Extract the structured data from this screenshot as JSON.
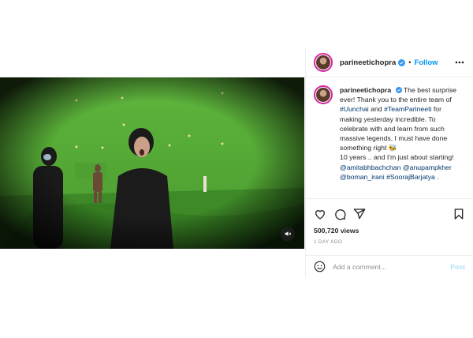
{
  "header": {
    "username": "parineetichopra",
    "separator": "•",
    "follow_label": "Follow"
  },
  "caption": {
    "username": "parineetichopra",
    "text_1": "The best surprise ever! Thank you to the entire team of",
    "tag_unchai": "#Uunchai",
    "and": "and",
    "tag_team": "#TeamParineeti",
    "text_2": "for making yesterday incredible. To celebrate with and learn from such massive legends, I must have done something right 🐝",
    "text_3": "10 years .. and I'm just about starting!",
    "mention_1": "@amitabhbachchan",
    "mention_2": "@anupampkher",
    "mention_3": "@boman_irani",
    "tag_sooraj": "#SoorajBarjatya",
    "end": "."
  },
  "stats": {
    "views": "500,720 views",
    "time": "1 DAY AGO"
  },
  "comment": {
    "placeholder": "Add a comment...",
    "post_label": "Post"
  },
  "icons": {
    "like": "heart-icon",
    "comment": "comment-icon",
    "share": "share-icon",
    "save": "bookmark-icon",
    "mute": "muted-speaker-icon",
    "more": "more-icon",
    "emoji": "emoji-icon"
  },
  "colors": {
    "accent": "#0095f6",
    "verified": "#3897f0",
    "greenscreen": "#5ba83a"
  }
}
